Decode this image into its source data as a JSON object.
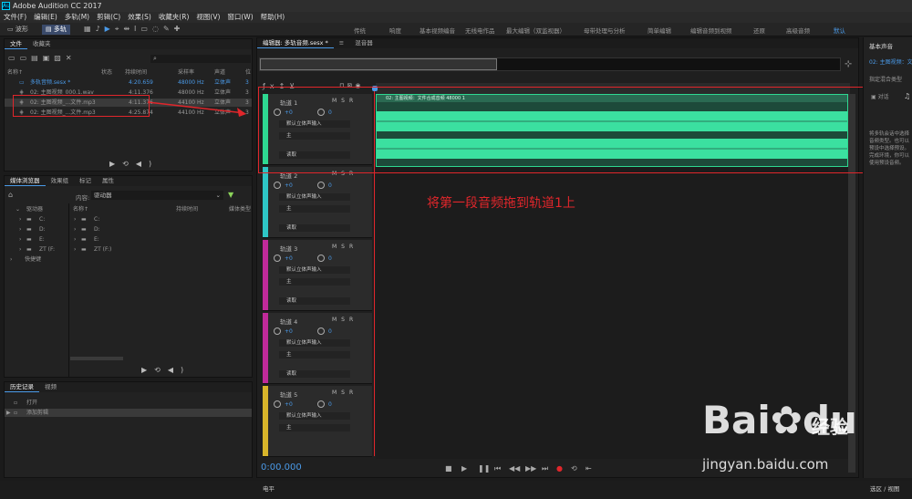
{
  "app": {
    "title": "Adobe Audition CC 2017",
    "logo": "Au"
  },
  "menu": [
    "文件(F)",
    "编辑(E)",
    "多轨(M)",
    "剪辑(C)",
    "效果(S)",
    "收藏夹(R)",
    "视图(V)",
    "窗口(W)",
    "帮助(H)"
  ],
  "toolbar": {
    "waveform": "波形",
    "multitrack": "多轨"
  },
  "workspaces": [
    "传统",
    "响度",
    "基本视频编音",
    "无线电作品",
    "最大编辑（双监视器）",
    "母带处理与分析",
    "简单编辑",
    "编辑音频到视频",
    "还原",
    "高级音频",
    "默认"
  ],
  "files_panel": {
    "tabs": [
      "文件",
      "收藏夹"
    ],
    "columns": [
      "名称↑",
      "状态",
      "持续时间",
      "采样率",
      "声道",
      "位"
    ],
    "rows": [
      {
        "name": "多轨音频.sesx *",
        "duration": "4:20.659",
        "rate": "48000 Hz",
        "channels": "立体声",
        "bits": "3"
      },
      {
        "name": "02: 主图视频_000.1.wav",
        "duration": "4:11.376",
        "rate": "48000 Hz",
        "channels": "立体声",
        "bits": "3"
      },
      {
        "name": "02: 主图视频_...文件.mp3",
        "duration": "4:11.376",
        "rate": "44100 Hz",
        "channels": "立体声",
        "bits": "3"
      },
      {
        "name": "02: 主图视频_...文件.mp3",
        "duration": "4:25.874",
        "rate": "44100 Hz",
        "channels": "立体声",
        "bits": "3"
      }
    ]
  },
  "media_panel": {
    "tabs": [
      "媒体浏览器",
      "效果组",
      "标记",
      "属性"
    ],
    "content_label": "内容:",
    "content_value": "驱动器",
    "tree": [
      "驱动器",
      "C:",
      "D:",
      "E:",
      "ZT (F:",
      "快捷键"
    ],
    "columns": [
      "名称↑",
      "持续时间",
      "媒体类型"
    ],
    "list": [
      "C:",
      "D:",
      "E:",
      "ZT (F:)"
    ]
  },
  "history_panel": {
    "tabs": [
      "历史记录",
      "视频"
    ],
    "items": [
      "打开",
      "添加剪辑"
    ]
  },
  "editor": {
    "tabs": [
      "编辑器: 多轨音频.sesx *",
      "混音器"
    ],
    "clip_label": "02: 主图视频：文件合成音频 48000 1",
    "timecode": "0:00.000",
    "tracks": [
      {
        "name": "轨道 1",
        "color": "#2ed891"
      },
      {
        "name": "轨道 2",
        "color": "#2ec6c6"
      },
      {
        "name": "轨道 3",
        "color": "#c02a9a"
      },
      {
        "name": "轨道 4",
        "color": "#c02a9a"
      },
      {
        "name": "轨道 5",
        "color": "#d8b52a"
      }
    ],
    "track_controls": {
      "msr": "MSR",
      "vol": "+0",
      "pan": "0",
      "input": "默认立体声输入",
      "output": "主",
      "mode": "读取"
    }
  },
  "annotation": "将第一段音频拖到轨道1上",
  "right_panel": {
    "title": "基本声音",
    "subtitle": "02: 主图视频：文",
    "assign": "指定混合类型",
    "dialog": "对话",
    "desc": "将多轨会话中选择音频类型。也可以预设中选择预设。完成环境，你可以使用预设音频。"
  },
  "bottom": {
    "level": "电平",
    "selection": "选区 / 视图"
  },
  "watermark": {
    "brand": "Bai",
    "brand2": "du",
    "sub": "经验",
    "url": "jingyan.baidu.com"
  }
}
